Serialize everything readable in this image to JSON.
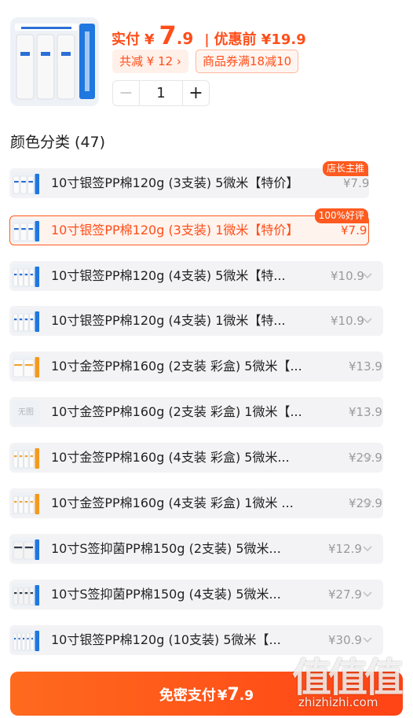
{
  "header": {
    "thumbnail_icon": "water-filter-cartridge-3pack-image",
    "pay_label": "实付",
    "currency": "¥",
    "pay_integer": "7",
    "pay_decimal": ".9",
    "separator": "|",
    "original_price": "优惠前 ¥19.9",
    "save_chip": "共减 ¥ 12 ›",
    "coupon_chip": "商品券满18减10",
    "quantity": "1",
    "minus_icon": "minus-icon",
    "plus_icon": "plus-icon"
  },
  "section": {
    "title": "颜色分类 (47)"
  },
  "options": [
    {
      "label": "10寸银签PP棉120g (3支装) 5微米【特价】",
      "price": "¥7.9",
      "badge": "店长主推",
      "icon": "silver-3pack-image",
      "selected": false,
      "chevron": false
    },
    {
      "label": "10寸银签PP棉120g (3支装) 1微米【特价】",
      "price": "¥7.9",
      "badge": "100%好评",
      "icon": "silver-3pack-image",
      "selected": true,
      "chevron": false
    },
    {
      "label": "10寸银签PP棉120g (4支装) 5微米【特...",
      "price": "¥10.9",
      "badge": "",
      "icon": "silver-4pack-image",
      "selected": false,
      "chevron": true
    },
    {
      "label": "10寸银签PP棉120g (4支装) 1微米【特...",
      "price": "¥10.9",
      "badge": "",
      "icon": "silver-4pack-image",
      "selected": false,
      "chevron": true
    },
    {
      "label": "10寸金签PP棉160g (2支装 彩盒) 5微米【...",
      "price": "¥13.9",
      "badge": "",
      "icon": "gold-2pack-image",
      "selected": false,
      "chevron": false
    },
    {
      "label": "10寸金签PP棉160g (2支装 彩盒) 1微米【...",
      "price": "¥13.9",
      "badge": "",
      "icon": "no-image-placeholder",
      "placeholder": "无图",
      "selected": false,
      "chevron": false
    },
    {
      "label": "10寸金签PP棉160g (4支装 彩盒) 5微米...",
      "price": "¥29.9",
      "badge": "",
      "icon": "gold-4pack-image",
      "selected": false,
      "chevron": true
    },
    {
      "label": "10寸金签PP棉160g (4支装 彩盒) 1微米 ...",
      "price": "¥29.9",
      "badge": "",
      "icon": "gold-4pack-image",
      "selected": false,
      "chevron": true
    },
    {
      "label": "10寸S签抑菌PP棉150g (2支装) 5微米...",
      "price": "¥12.9",
      "badge": "",
      "icon": "dark-2pack-image",
      "selected": false,
      "chevron": true
    },
    {
      "label": "10寸S签抑菌PP棉150g (4支装) 5微米...",
      "price": "¥27.9",
      "badge": "",
      "icon": "dark-4pack-image",
      "selected": false,
      "chevron": true
    },
    {
      "label": "10寸银签PP棉120g (10支装) 5微米【...",
      "price": "¥30.9",
      "badge": "",
      "icon": "silver-10pack-image",
      "selected": false,
      "chevron": true
    }
  ],
  "pay_button": {
    "label": "免密支付",
    "currency": "¥",
    "integer": "7",
    "decimal": ".9"
  },
  "watermark": {
    "glyphs": "值值值",
    "url": "zhizhizhi.com"
  },
  "colors": {
    "accent": "#ff4e1a",
    "option_bg": "#f3f3f5",
    "muted": "#9a9a9a"
  }
}
